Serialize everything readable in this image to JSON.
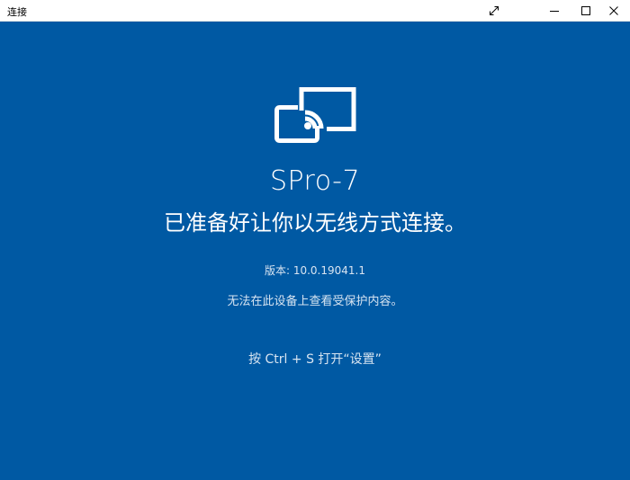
{
  "window": {
    "title": "连接",
    "controls": {
      "fullscreen_icon": "expand-diagonal-icon",
      "minimize_icon": "minimize-icon",
      "maximize_icon": "maximize-icon",
      "close_icon": "close-icon"
    }
  },
  "main": {
    "icon": "wireless-display-cast-icon",
    "device_name": "SPro-7",
    "ready_message": "已准备好让你以无线方式连接。",
    "version": "版本: 10.0.19041.1",
    "protected_notice": "无法在此设备上查看受保护内容。",
    "settings_hint": "按 Ctrl + S 打开“设置”"
  },
  "colors": {
    "background": "#0059A3",
    "titlebar": "#FFFFFF",
    "primary_text": "#FFFFFF",
    "secondary_text": "#D7E4F1"
  }
}
